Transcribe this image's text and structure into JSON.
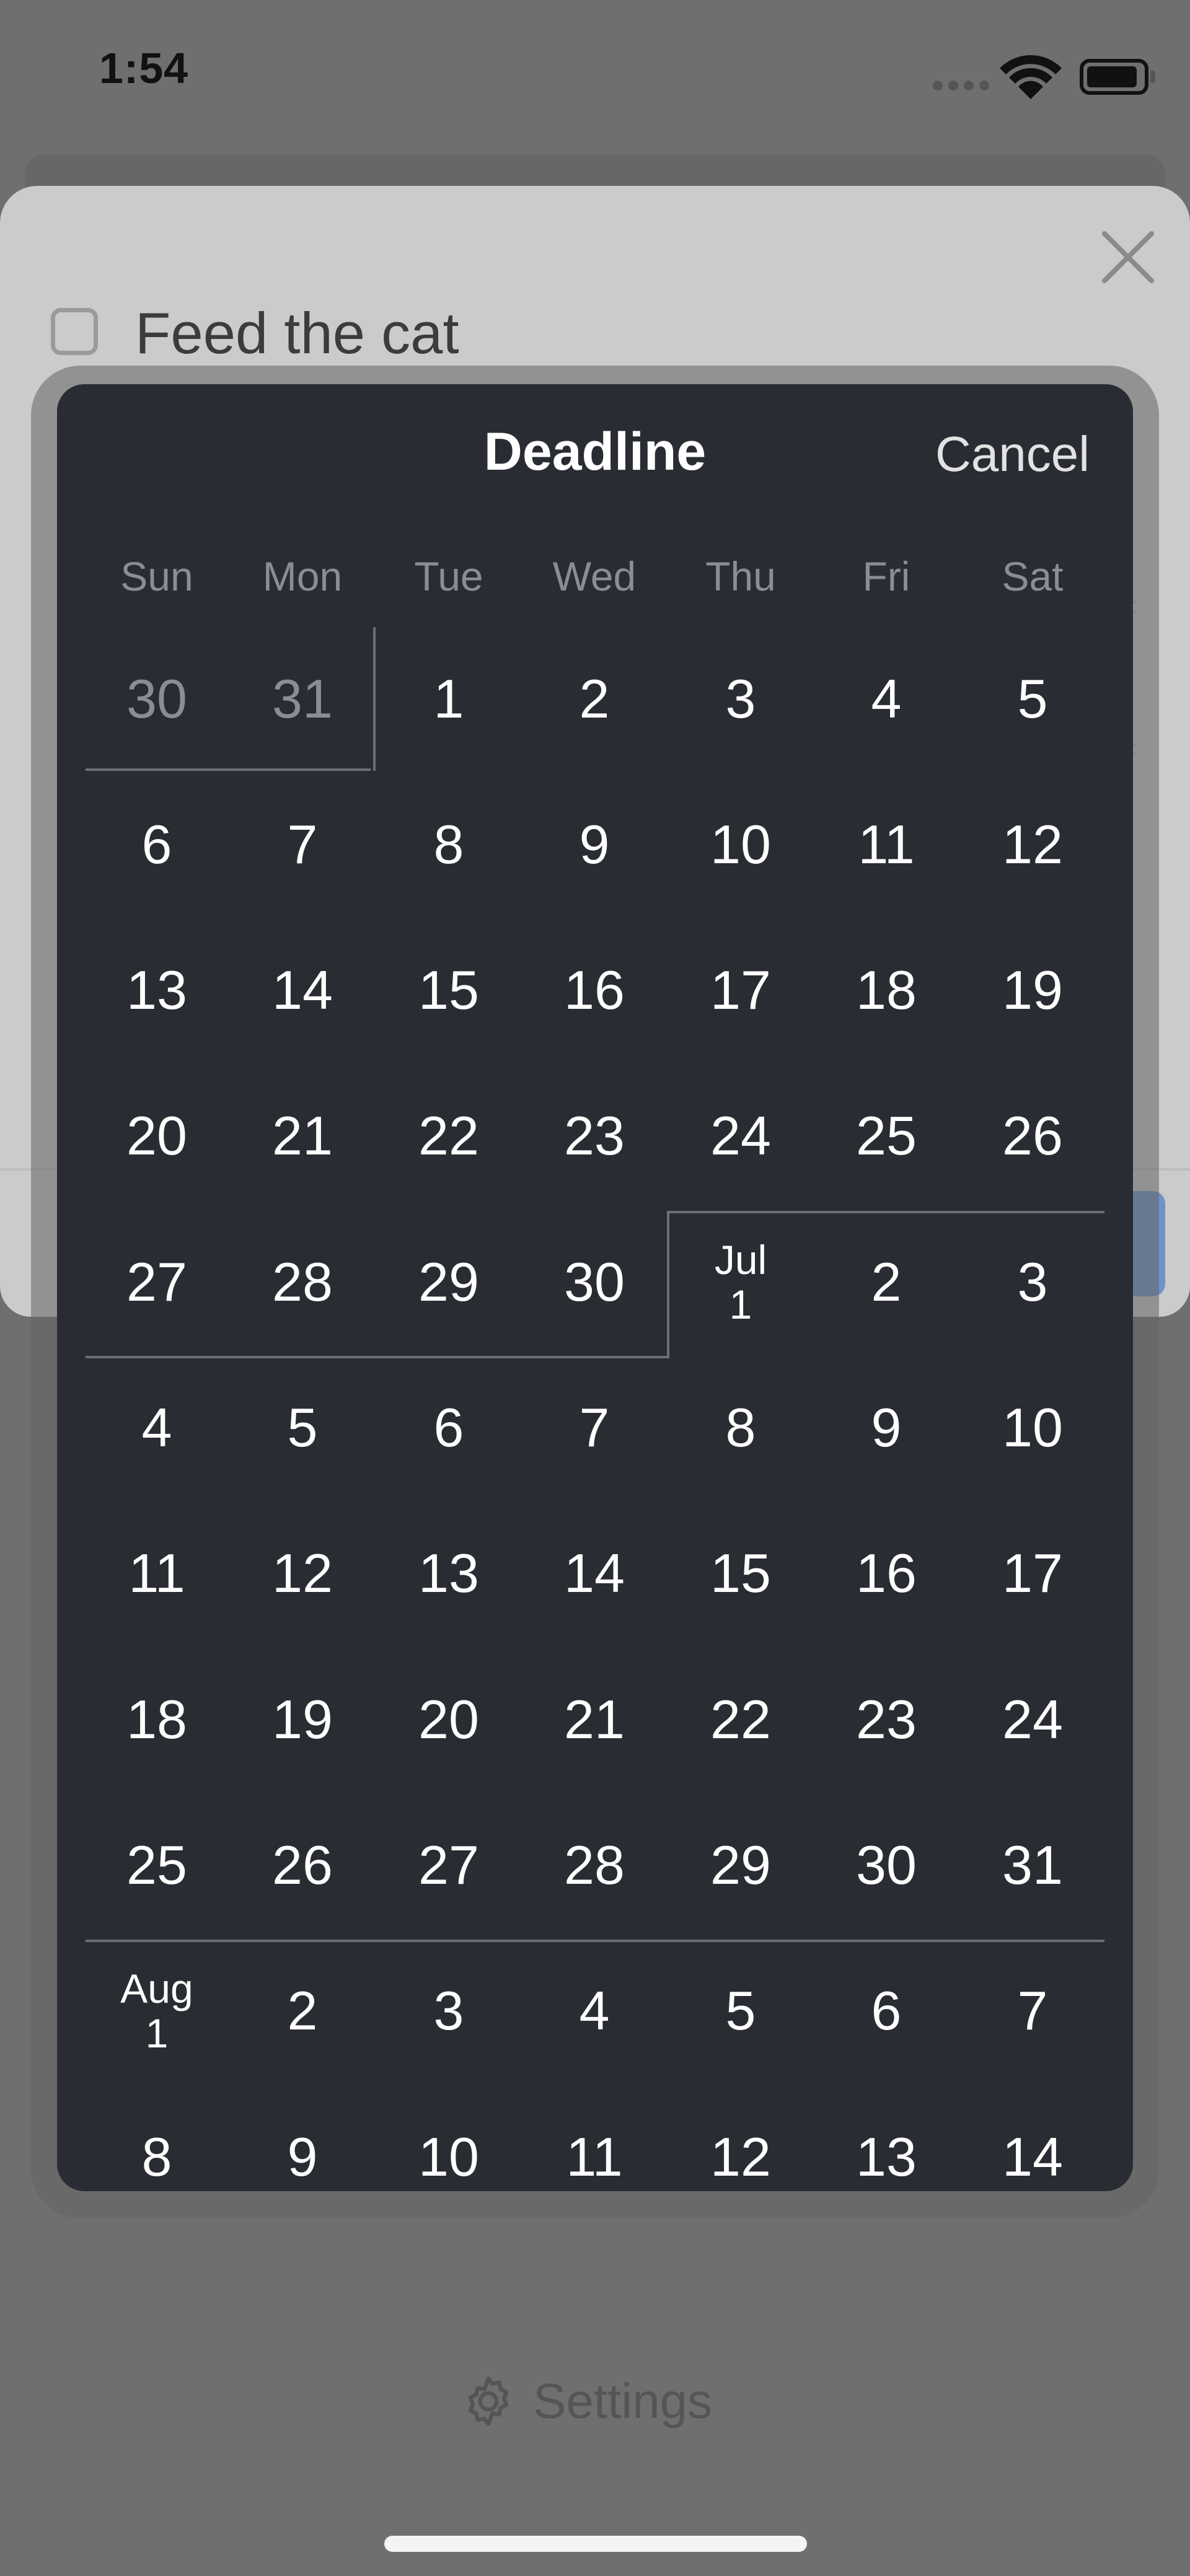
{
  "status_bar": {
    "time": "1:54"
  },
  "task": {
    "title": "Feed the cat"
  },
  "picker": {
    "title": "Deadline",
    "cancel_label": "Cancel",
    "weekdays": [
      "Sun",
      "Mon",
      "Tue",
      "Wed",
      "Thu",
      "Fri",
      "Sat"
    ],
    "weeks": [
      [
        {
          "d": "30",
          "dim": true
        },
        {
          "d": "31",
          "dim": true
        },
        {
          "d": "1"
        },
        {
          "d": "2"
        },
        {
          "d": "3"
        },
        {
          "d": "4"
        },
        {
          "d": "5"
        }
      ],
      [
        {
          "d": "6"
        },
        {
          "d": "7"
        },
        {
          "d": "8"
        },
        {
          "d": "9"
        },
        {
          "d": "10"
        },
        {
          "d": "11"
        },
        {
          "d": "12"
        }
      ],
      [
        {
          "d": "13"
        },
        {
          "d": "14"
        },
        {
          "d": "15"
        },
        {
          "d": "16"
        },
        {
          "d": "17"
        },
        {
          "d": "18"
        },
        {
          "d": "19"
        }
      ],
      [
        {
          "d": "20"
        },
        {
          "d": "21"
        },
        {
          "d": "22"
        },
        {
          "d": "23"
        },
        {
          "d": "24"
        },
        {
          "d": "25"
        },
        {
          "d": "26"
        }
      ],
      [
        {
          "d": "27"
        },
        {
          "d": "28"
        },
        {
          "d": "29"
        },
        {
          "d": "30"
        },
        {
          "d": "1",
          "m": "Jul"
        },
        {
          "d": "2"
        },
        {
          "d": "3"
        }
      ],
      [
        {
          "d": "4"
        },
        {
          "d": "5"
        },
        {
          "d": "6"
        },
        {
          "d": "7"
        },
        {
          "d": "8"
        },
        {
          "d": "9"
        },
        {
          "d": "10"
        }
      ],
      [
        {
          "d": "11"
        },
        {
          "d": "12"
        },
        {
          "d": "13"
        },
        {
          "d": "14"
        },
        {
          "d": "15"
        },
        {
          "d": "16"
        },
        {
          "d": "17"
        }
      ],
      [
        {
          "d": "18"
        },
        {
          "d": "19"
        },
        {
          "d": "20"
        },
        {
          "d": "21"
        },
        {
          "d": "22"
        },
        {
          "d": "23"
        },
        {
          "d": "24"
        }
      ],
      [
        {
          "d": "25"
        },
        {
          "d": "26"
        },
        {
          "d": "27"
        },
        {
          "d": "28"
        },
        {
          "d": "29"
        },
        {
          "d": "30"
        },
        {
          "d": "31"
        }
      ],
      [
        {
          "d": "1",
          "m": "Aug"
        },
        {
          "d": "2"
        },
        {
          "d": "3"
        },
        {
          "d": "4"
        },
        {
          "d": "5"
        },
        {
          "d": "6"
        },
        {
          "d": "7"
        }
      ],
      [
        {
          "d": "8"
        },
        {
          "d": "9"
        },
        {
          "d": "10"
        },
        {
          "d": "11"
        },
        {
          "d": "12"
        },
        {
          "d": "13"
        },
        {
          "d": "14"
        }
      ]
    ]
  },
  "footer": {
    "settings_label": "Settings",
    "icon": "gear-icon"
  },
  "colors": {
    "picker_bg": "#292c33",
    "accent": "#6f93c9",
    "dim_text": "#8b8d92"
  }
}
